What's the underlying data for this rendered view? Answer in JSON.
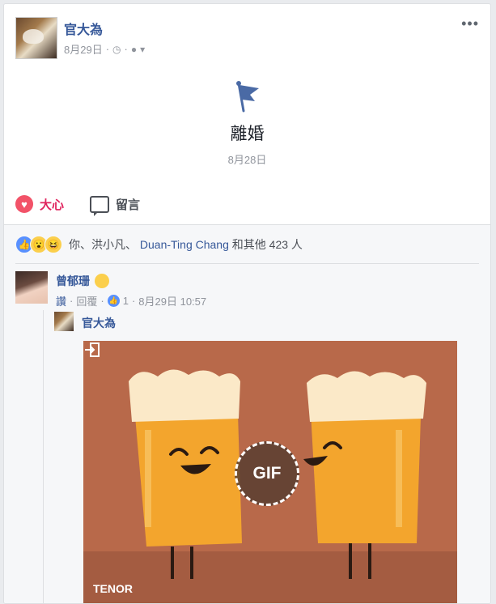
{
  "post": {
    "author": "官大為",
    "date": "8月29日",
    "meta_separator": "·",
    "options_label": "•••"
  },
  "event": {
    "title": "離婚",
    "date": "8月28日"
  },
  "actions": {
    "love_label": "大心",
    "comment_label": "留言"
  },
  "reactions": {
    "prefix": "你、洪小凡、",
    "names_link": "Duan-Ting Chang",
    "suffix": "和其他 423 人"
  },
  "comment": {
    "author": "曾郁珊",
    "like_link": "讚",
    "reply_link": "回覆",
    "like_count": "1",
    "timestamp": "8月29日 10:57",
    "dot": "·"
  },
  "reply": {
    "author": "官大為",
    "gif_badge": "GIF",
    "gif_source": "TENOR"
  },
  "colors": {
    "link": "#365899",
    "love": "#e0245e",
    "gif_background": "#b8694a"
  }
}
